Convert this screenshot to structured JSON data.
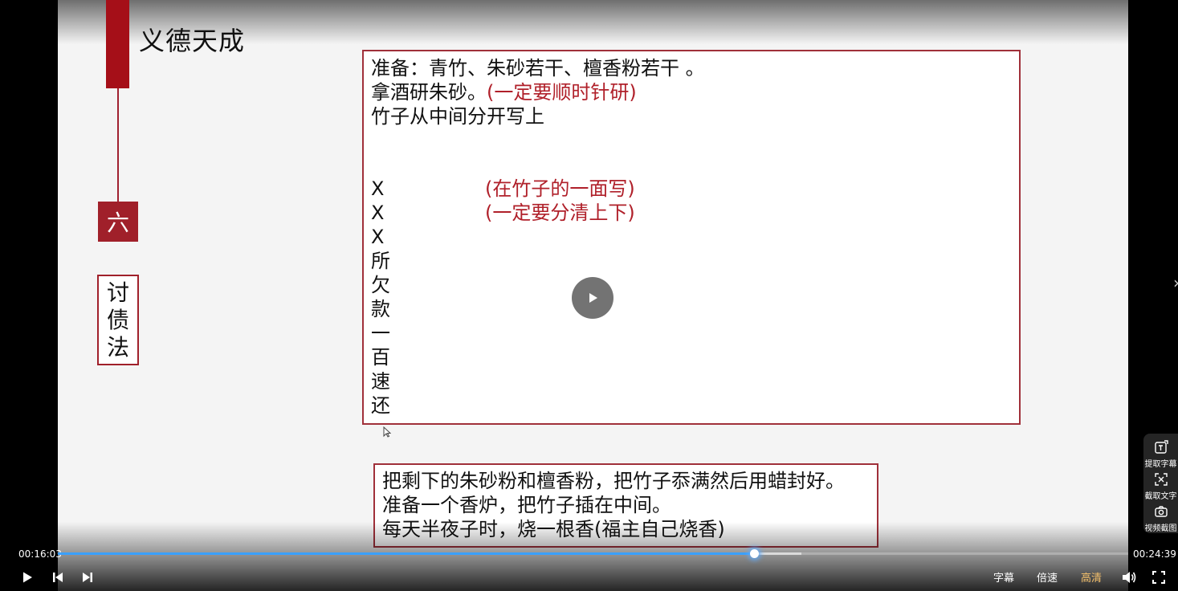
{
  "slide": {
    "title": "义德天成",
    "section_number": "六",
    "vertical_label": [
      "讨",
      "债",
      "法"
    ],
    "box1": {
      "line1": "准备：青竹、朱砂若干、檀香粉若干 。",
      "line2_black": "拿酒研朱砂。",
      "line2_red": "(一定要顺时针研)",
      "line3": "竹子从中间分开写上",
      "note1": "(在竹子的一面写)",
      "note2": "(一定要分清上下)",
      "vertical_chars": [
        "X",
        "X",
        "X",
        "所",
        "欠",
        "款",
        "一",
        "百",
        "速",
        "还"
      ]
    },
    "box2": {
      "line1": "把剩下的朱砂粉和檀香粉，把竹子忝满然后用蜡封好。",
      "line2": "准备一个香炉，把竹子插在中间。",
      "line3": "每天半夜子时，烧一根香(福主自己烧香)"
    }
  },
  "player": {
    "current_time": "00:16:03",
    "total_time": "00:24:39",
    "progress_fraction": 0.6507,
    "buffered_fraction": 0.695,
    "subtitle_label": "字幕",
    "speed_label": "倍速",
    "quality_label": "高清",
    "accent_color": "#3aa0ff",
    "quality_color": "#f5c16c"
  },
  "side_panel": {
    "items": [
      {
        "label": "提取字幕",
        "icon": "text-extract-icon"
      },
      {
        "label": "截取文字",
        "icon": "text-capture-icon"
      },
      {
        "label": "视频截图",
        "icon": "camera-icon"
      }
    ]
  }
}
